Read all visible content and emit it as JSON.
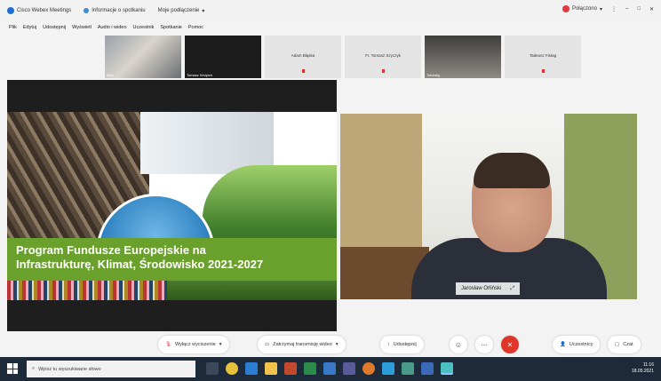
{
  "titlebar": {
    "tab1": "Cisco Webex Meetings",
    "tab2": "Informacje o spotkaniu",
    "tab3": "Moje podłączenie",
    "status": "Połączono",
    "colors": {
      "webex": "#1f6fd1",
      "status": "#e03a3a"
    }
  },
  "menu": [
    "Plik",
    "Edytuj",
    "Udostępnij",
    "Wyświetl",
    "Audio i wideo",
    "Uczestnik",
    "Spotkanie",
    "Pomoc"
  ],
  "participants": [
    {
      "name": "Błaż"
    },
    {
      "name": "Tomasz Wulpich"
    },
    {
      "name": "Adam Błąska"
    },
    {
      "name": "Fr. Tomasz Szyczyk"
    },
    {
      "name": "Tolubieg"
    },
    {
      "name": "Tadeusz Fistag"
    }
  ],
  "slide": {
    "title": "Program Fundusze Europejskie na\nInfrastrukturę, Klimat, Środowisko 2021-2027",
    "banner_color": "#6aa02c"
  },
  "speaker": {
    "name": "Jarosław Orliński"
  },
  "controls": {
    "mute": "Wyłącz wyciszenie",
    "video": "Zatrzymaj transmisję wideo",
    "share": "Udostępnij",
    "participants": "Uczestnicy",
    "chat": "Czat",
    "end_color": "#e0352b"
  },
  "taskbar": {
    "search_placeholder": "Wpisz tu wyszukiwane słowo",
    "time": "11:16",
    "date": "18.05.2021"
  }
}
